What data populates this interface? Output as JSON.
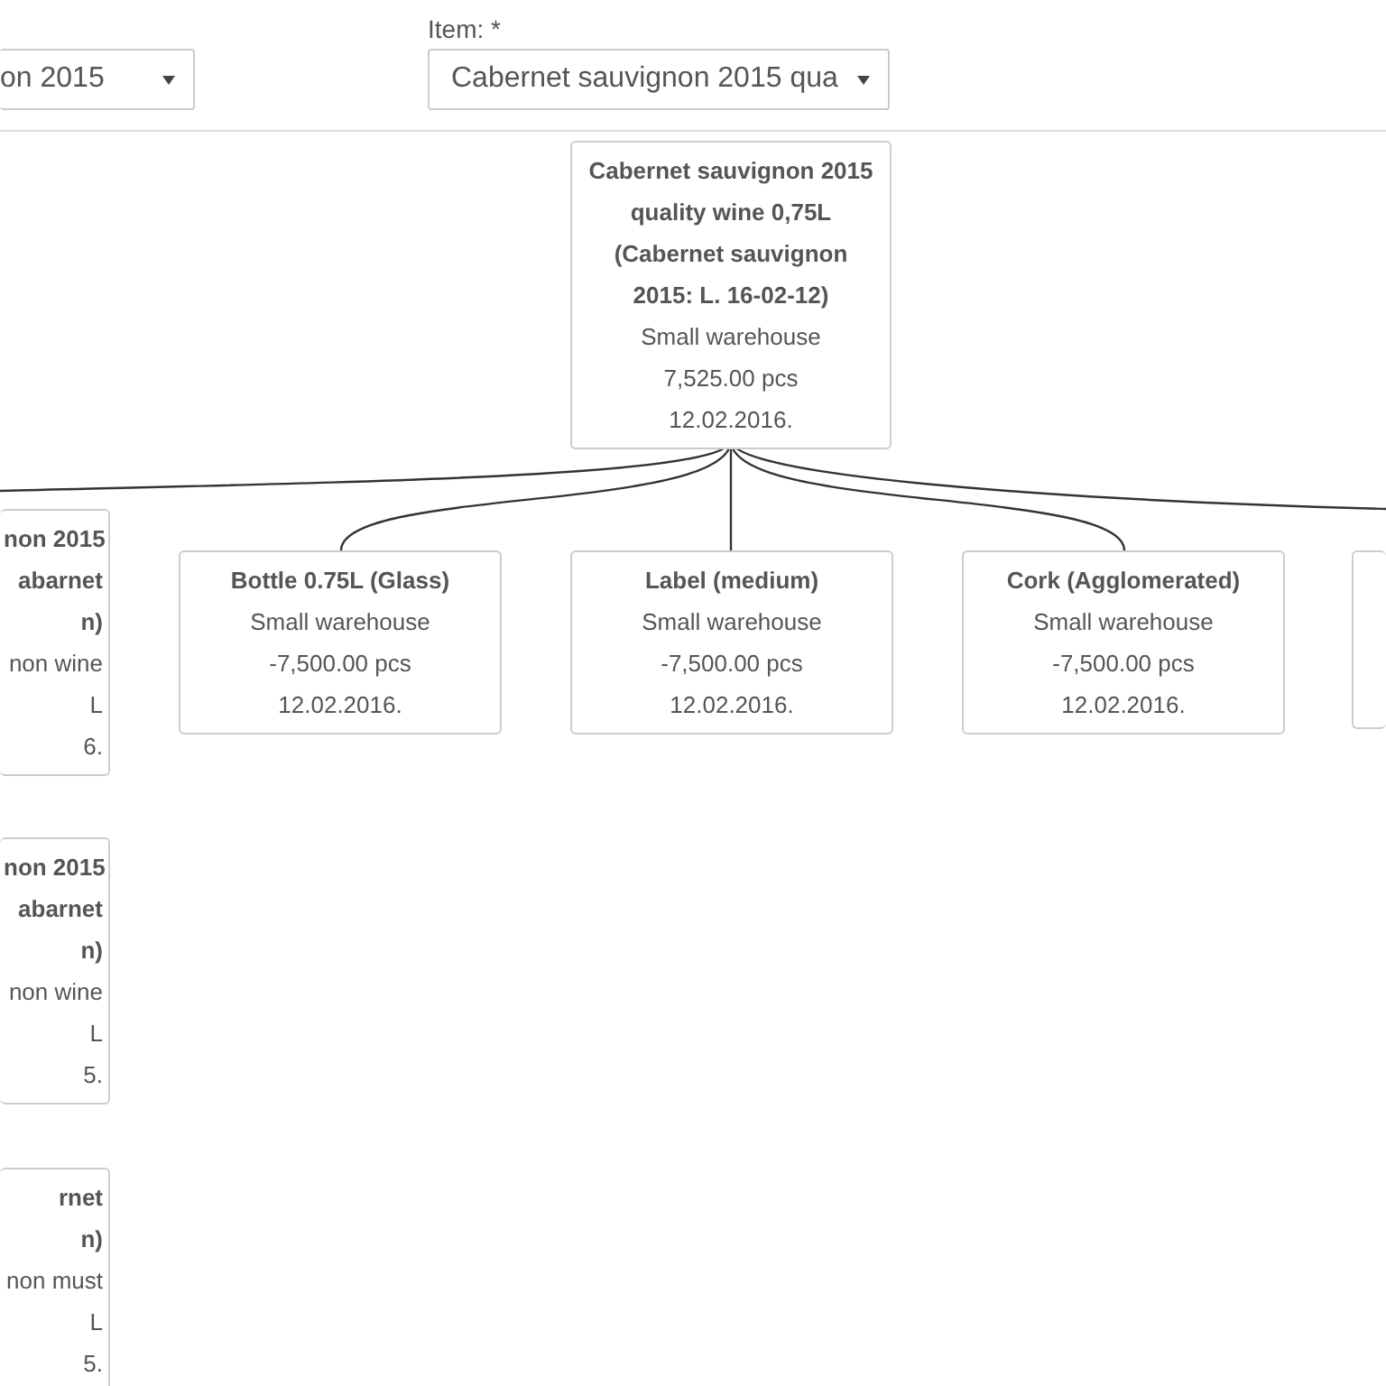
{
  "filters": [
    {
      "value": "on 2015"
    },
    {
      "label": "Item: *",
      "value": "Cabernet sauvignon 2015 qua"
    }
  ],
  "tree": {
    "root": {
      "title_lines": [
        "Cabernet sauvignon 2015",
        "quality wine 0,75L",
        "(Cabernet sauvignon",
        "2015: L. 16-02-12)"
      ],
      "lines": [
        "Small warehouse",
        "7,525.00 pcs",
        "12.02.2016."
      ]
    },
    "children": [
      {
        "kind": "clipped-left",
        "title_lines": [
          "non 2015",
          "abarnet",
          "n)"
        ],
        "lines": [
          "non wine",
          "L",
          "6."
        ]
      },
      {
        "kind": "clipped-left",
        "title_lines": [
          "non 2015",
          "abarnet",
          "n)"
        ],
        "lines": [
          "non wine",
          "L",
          "5."
        ]
      },
      {
        "kind": "clipped-left",
        "title_lines": [
          "rnet",
          "n)"
        ],
        "lines": [
          "non must",
          "L",
          "5."
        ]
      },
      {
        "kind": "full",
        "title_lines": [
          "Bottle 0.75L (Glass)"
        ],
        "lines": [
          "Small warehouse",
          "-7,500.00 pcs",
          "12.02.2016."
        ]
      },
      {
        "kind": "full",
        "title_lines": [
          "Label (medium)"
        ],
        "lines": [
          "Small warehouse",
          "-7,500.00 pcs",
          "12.02.2016."
        ]
      },
      {
        "kind": "full",
        "title_lines": [
          "Cork (Agglomerated)"
        ],
        "lines": [
          "Small warehouse",
          "-7,500.00 pcs",
          "12.02.2016."
        ]
      },
      {
        "kind": "clipped-right"
      }
    ]
  }
}
